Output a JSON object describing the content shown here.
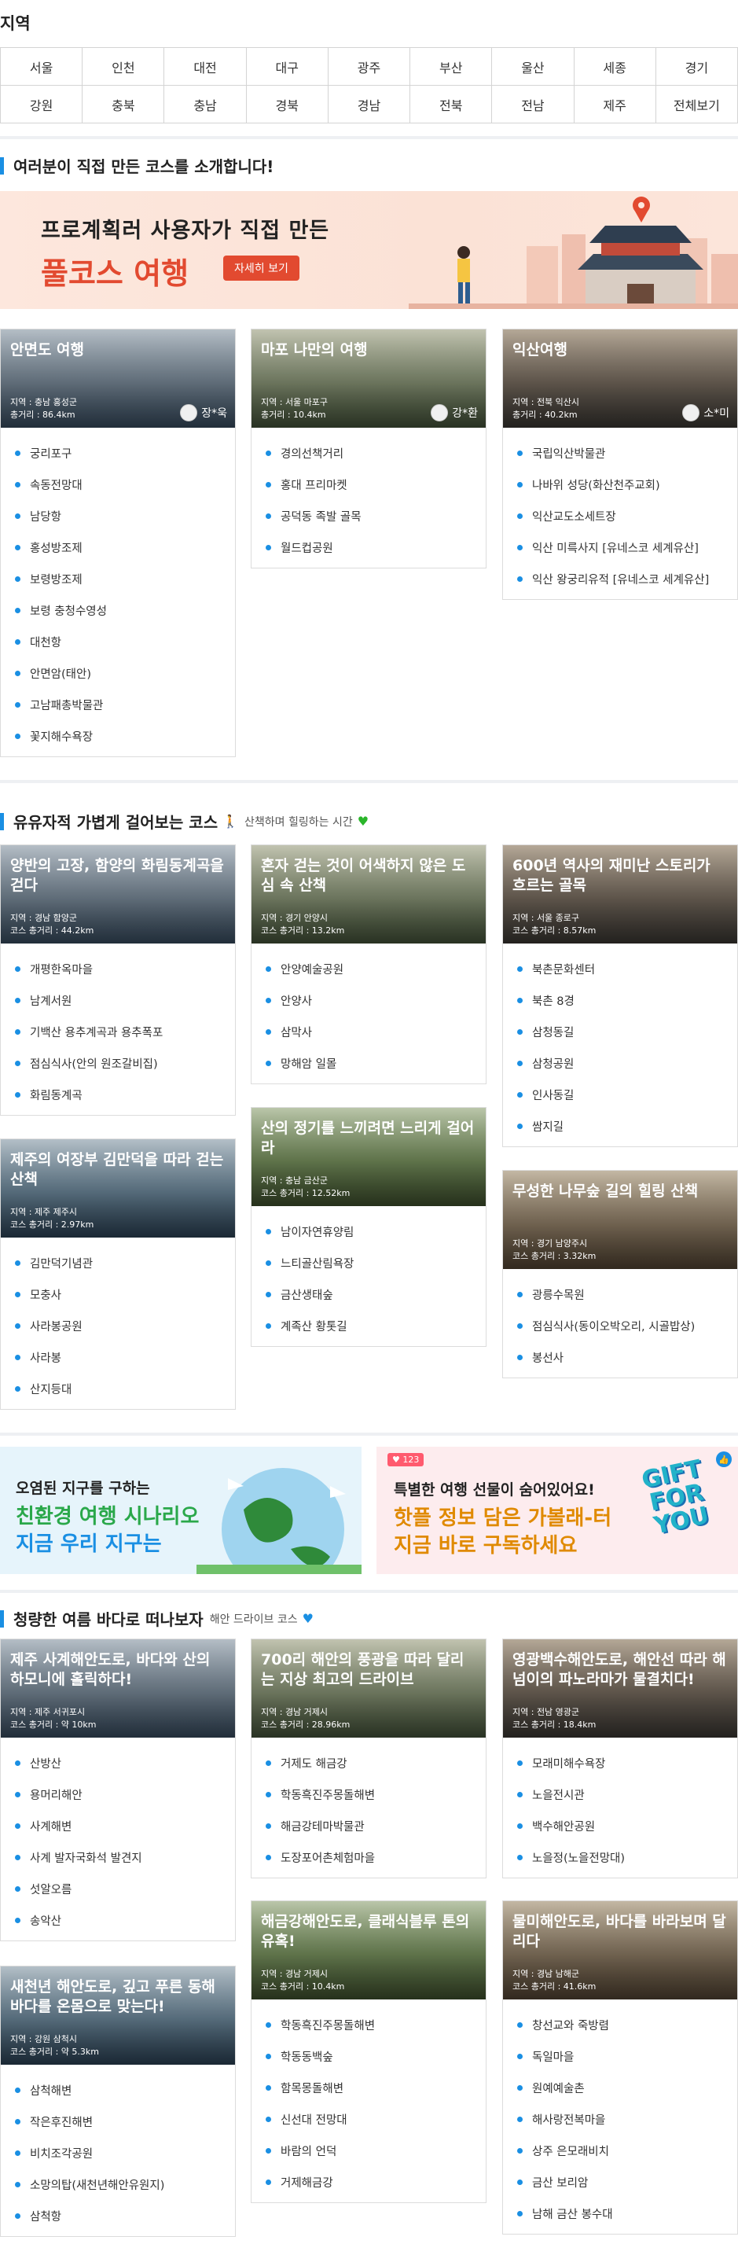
{
  "region": {
    "title": "지역",
    "cells": [
      "서울",
      "인천",
      "대전",
      "대구",
      "광주",
      "부산",
      "울산",
      "세종",
      "경기",
      "강원",
      "충북",
      "충남",
      "경북",
      "경남",
      "전북",
      "전남",
      "제주",
      "전체보기"
    ]
  },
  "section1": {
    "title": "여러분이 직접 만든 코스를 소개합니다!",
    "banner": {
      "line1": "프로계획러 사용자가 직접 만든",
      "line2": "풀코스 여행",
      "button": "자세히 보기"
    },
    "cards": [
      {
        "title": "안면도 여행",
        "region": "지역 : 충남 홍성군",
        "distance": "총거리 : 86.4km",
        "author": "장*욱",
        "items": [
          "궁리포구",
          "속동전망대",
          "남당항",
          "홍성방조제",
          "보령방조제",
          "보령 충청수영성",
          "대천항",
          "안면암(태안)",
          "고남패총박물관",
          "꽃지해수욕장"
        ]
      },
      {
        "title": "마포 나만의 여행",
        "region": "지역 : 서울 마포구",
        "distance": "총거리 : 10.4km",
        "author": "강*환",
        "items": [
          "경의선책거리",
          "홍대 프리마켓",
          "공덕동 족발 골목",
          "월드컵공원"
        ]
      },
      {
        "title": "익산여행",
        "region": "지역 : 전북 익산시",
        "distance": "총거리 : 40.2km",
        "author": "소*미",
        "items": [
          "국립익산박물관",
          "나바위 성당(화산천주교회)",
          "익산교도소세트장",
          "익산 미륵사지 [유네스코 세계유산]",
          "익산 왕궁리유적 [유네스코 세계유산]"
        ]
      }
    ]
  },
  "section2": {
    "title": "유유자적 가볍게 걸어보는 코스",
    "subtitle": "산책하며 힐링하는 시간",
    "cards": [
      {
        "title": "양반의 고장, 함양의 화림동계곡을 걷다",
        "region": "지역 : 경남 함양군",
        "distance": "코스 총거리 : 44.2km",
        "items": [
          "개평한옥마을",
          "남계서원",
          "기백산 용추계곡과 용추폭포",
          "점심식사(안의 원조갈비집)",
          "화림동계곡"
        ]
      },
      {
        "title": "혼자 걷는 것이 어색하지 않은 도심 속 산책",
        "region": "지역 : 경기 안양시",
        "distance": "코스 총거리 : 13.2km",
        "items": [
          "안양예술공원",
          "안양사",
          "삼막사",
          "망해암 일몰"
        ]
      },
      {
        "title": "600년 역사의 재미난 스토리가 흐르는 골목",
        "region": "지역 : 서울 종로구",
        "distance": "코스 총거리 : 8.57km",
        "items": [
          "북촌문화센터",
          "북촌 8경",
          "삼청동길",
          "삼청공원",
          "인사동길",
          "쌈지길"
        ]
      },
      {
        "title": "제주의 여장부 김만덕을 따라 걷는 산책",
        "region": "지역 : 제주 제주시",
        "distance": "코스 총거리 : 2.97km",
        "items": [
          "김만덕기념관",
          "모충사",
          "사라봉공원",
          "사라봉",
          "산지등대"
        ]
      },
      {
        "title": "산의 정기를 느끼려면 느리게 걸어라",
        "region": "지역 : 충남 금산군",
        "distance": "코스 총거리 : 12.52km",
        "items": [
          "남이자연휴양림",
          "느티골산림욕장",
          "금산생태숲",
          "계족산 황톳길"
        ]
      },
      {
        "title": "무성한 나무숲 길의 힐링 산책",
        "region": "지역 : 경기 남양주시",
        "distance": "코스 총거리 : 3.32km",
        "items": [
          "광릉수목원",
          "점심식사(동이오박오리, 시골밥상)",
          "봉선사"
        ]
      }
    ]
  },
  "banners": {
    "left": {
      "line1": "오염된 지구를 구하는",
      "line2": "친환경 여행 시나리오",
      "line3": "지금 우리 지구는"
    },
    "right": {
      "badge": "123",
      "line1": "특별한 여행 선물이 숨어있어요!",
      "line2": "핫플 정보 담은 가볼래-터",
      "line3": "지금 바로 구독하세요",
      "art": "GIFT FOR YOU"
    }
  },
  "section3": {
    "title": "청량한 여름 바다로 떠나보자",
    "subtitle": "해안 드라이브 코스",
    "cards": [
      {
        "title": "제주 사계해안도로, 바다와 산의 하모니에 홀릭하다!",
        "region": "지역 : 제주 서귀포시",
        "distance": "코스 총거리 : 약 10km",
        "items": [
          "산방산",
          "용머리해안",
          "사계해변",
          "사계 발자국화석 발견지",
          "섯알오름",
          "송악산"
        ]
      },
      {
        "title": "700리 해안의 풍광을 따라 달리는 지상 최고의 드라이브",
        "region": "지역 : 경남 거제시",
        "distance": "코스 총거리 : 28.96km",
        "items": [
          "거제도 해금강",
          "학동흑진주몽돌해변",
          "해금강테마박물관",
          "도장포어촌체험마을"
        ]
      },
      {
        "title": "영광백수해안도로, 해안선 따라 해넘이의 파노라마가 물결치다!",
        "region": "지역 : 전남 영광군",
        "distance": "코스 총거리 : 18.4km",
        "items": [
          "모래미해수욕장",
          "노을전시관",
          "백수해안공원",
          "노을정(노을전망대)"
        ]
      },
      {
        "title": "새천년 해안도로, 깊고 푸른 동해 바다를 온몸으로 맞는다!",
        "region": "지역 : 강원 삼척시",
        "distance": "코스 총거리 : 약 5.3km",
        "items": [
          "삼척해변",
          "작은후진해변",
          "비치조각공원",
          "소망의탑(새천년해안유원지)",
          "삼척항"
        ]
      },
      {
        "title": "해금강해안도로, 클래식블루 톤의 유혹!",
        "region": "지역 : 경남 거제시",
        "distance": "코스 총거리 : 10.4km",
        "items": [
          "학동흑진주몽돌해변",
          "학동동백숲",
          "함목몽돌해변",
          "신선대 전망대",
          "바람의 언덕",
          "거제해금강"
        ]
      },
      {
        "title": "물미해안도로, 바다를 바라보며 달리다",
        "region": "지역 : 경남 남해군",
        "distance": "코스 총거리 : 41.6km",
        "items": [
          "창선교와 죽방렴",
          "독일마을",
          "원예예술촌",
          "해사랑전복마을",
          "상주 은모래비치",
          "금산 보리암",
          "남해 금산 봉수대"
        ]
      }
    ]
  }
}
